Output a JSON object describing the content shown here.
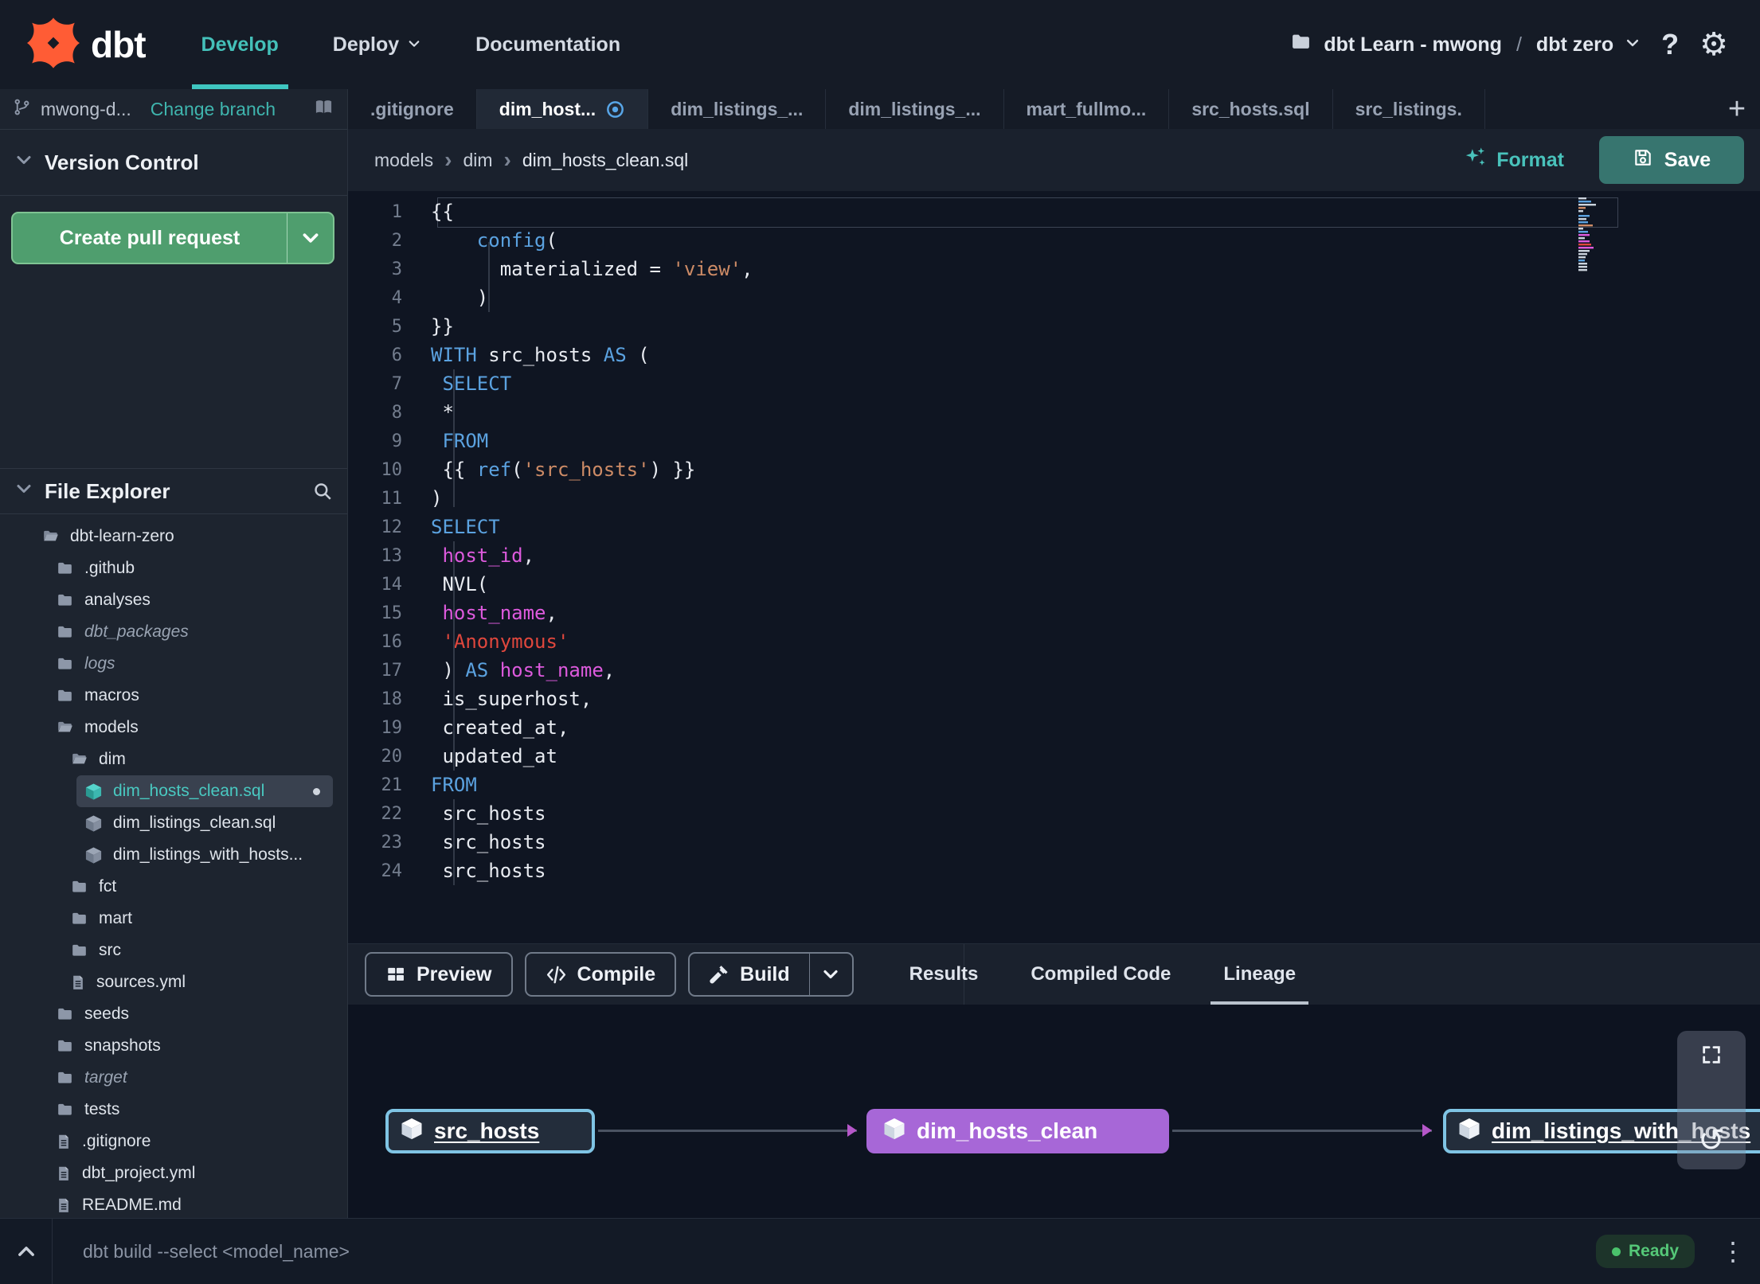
{
  "navbar": {
    "brand": "dbt",
    "items": [
      {
        "label": "Develop",
        "active": true,
        "chevron": false
      },
      {
        "label": "Deploy",
        "active": false,
        "chevron": true
      },
      {
        "label": "Documentation",
        "active": false,
        "chevron": false
      }
    ],
    "project": {
      "account": "dbt Learn - mwong",
      "separator": "/",
      "environment": "dbt zero"
    }
  },
  "icons": {
    "help": "?",
    "gear": "⚙",
    "undo": "↺",
    "kebab": "⋮",
    "plus": "+"
  },
  "colors": {
    "accent_teal": "#45c0ba",
    "brand_orange": "#ff5c35",
    "pr_green": "#4f9e6e",
    "node_purple": "#a767d7",
    "node_blue": "#7fc4e4",
    "ready_green": "#4ac26b",
    "modified_blue": "#58a6e8",
    "keyword_blue": "#5ba2e0",
    "ident_magenta": "#dd5add",
    "string_red": "#e0473d",
    "string_orange": "#cd8b66"
  },
  "sidebar": {
    "branch": {
      "name": "mwong-d...",
      "change_label": "Change branch"
    },
    "version_control": {
      "title": "Version Control",
      "create_pr_label": "Create pull request"
    },
    "file_explorer": {
      "title": "File Explorer",
      "tree": [
        {
          "name": "dbt-learn-zero",
          "type": "folder-open",
          "level": 0
        },
        {
          "name": ".github",
          "type": "folder",
          "level": 1
        },
        {
          "name": "analyses",
          "type": "folder",
          "level": 1
        },
        {
          "name": "dbt_packages",
          "type": "folder",
          "level": 1,
          "muted": true
        },
        {
          "name": "logs",
          "type": "folder",
          "level": 1,
          "muted": true
        },
        {
          "name": "macros",
          "type": "folder",
          "level": 1
        },
        {
          "name": "models",
          "type": "folder-open",
          "level": 1
        },
        {
          "name": "dim",
          "type": "folder-open",
          "level": 2
        },
        {
          "name": "dim_hosts_clean.sql",
          "type": "model",
          "level": 3,
          "selected": true,
          "modified": true
        },
        {
          "name": "dim_listings_clean.sql",
          "type": "model",
          "level": 3
        },
        {
          "name": "dim_listings_with_hosts...",
          "type": "model",
          "level": 3
        },
        {
          "name": "fct",
          "type": "folder",
          "level": 2
        },
        {
          "name": "mart",
          "type": "folder",
          "level": 2
        },
        {
          "name": "src",
          "type": "folder",
          "level": 2
        },
        {
          "name": "sources.yml",
          "type": "file",
          "level": 2
        },
        {
          "name": "seeds",
          "type": "folder",
          "level": 1
        },
        {
          "name": "snapshots",
          "type": "folder",
          "level": 1
        },
        {
          "name": "target",
          "type": "folder",
          "level": 1,
          "muted": true
        },
        {
          "name": "tests",
          "type": "folder",
          "level": 1
        },
        {
          "name": ".gitignore",
          "type": "file",
          "level": 1
        },
        {
          "name": "dbt_project.yml",
          "type": "file",
          "level": 1
        },
        {
          "name": "README.md",
          "type": "file",
          "level": 1
        }
      ]
    }
  },
  "tabs": [
    {
      "label": ".gitignore"
    },
    {
      "label": "dim_host...",
      "active": true,
      "modified": true
    },
    {
      "label": "dim_listings_..."
    },
    {
      "label": "dim_listings_..."
    },
    {
      "label": "mart_fullmo..."
    },
    {
      "label": "src_hosts.sql"
    },
    {
      "label": "src_listings."
    }
  ],
  "editor": {
    "breadcrumb": [
      "models",
      "dim",
      "dim_hosts_clean.sql"
    ],
    "format_label": "Format",
    "save_label": "Save",
    "lines": [
      {
        "n": 1,
        "segs": [
          [
            "{{",
            "w"
          ]
        ]
      },
      {
        "n": 2,
        "segs": [
          [
            "    ",
            "w"
          ],
          [
            "config",
            "k"
          ],
          [
            "(",
            "w"
          ]
        ]
      },
      {
        "n": 3,
        "segs": [
          [
            "      materialized = ",
            "w"
          ],
          [
            "'view'",
            "o"
          ],
          [
            ",",
            "w"
          ]
        ]
      },
      {
        "n": 4,
        "segs": [
          [
            "    )",
            "w"
          ]
        ]
      },
      {
        "n": 5,
        "segs": [
          [
            "}}",
            "w"
          ]
        ]
      },
      {
        "n": 6,
        "segs": [
          [
            "WITH",
            "k"
          ],
          [
            " src_hosts ",
            "w"
          ],
          [
            "AS",
            "k"
          ],
          [
            " (",
            "w"
          ]
        ]
      },
      {
        "n": 7,
        "segs": [
          [
            " ",
            "w"
          ],
          [
            "SELECT",
            "k"
          ]
        ]
      },
      {
        "n": 8,
        "segs": [
          [
            " *",
            "w"
          ]
        ]
      },
      {
        "n": 9,
        "segs": [
          [
            " ",
            "w"
          ],
          [
            "FROM",
            "k"
          ]
        ]
      },
      {
        "n": 10,
        "segs": [
          [
            " {{ ",
            "w"
          ],
          [
            "ref",
            "k"
          ],
          [
            "(",
            "w"
          ],
          [
            "'src_hosts'",
            "o"
          ],
          [
            ") }}",
            "w"
          ]
        ]
      },
      {
        "n": 11,
        "segs": [
          [
            ")",
            "w"
          ]
        ]
      },
      {
        "n": 12,
        "segs": [
          [
            "SELECT",
            "k"
          ]
        ]
      },
      {
        "n": 13,
        "segs": [
          [
            " ",
            "w"
          ],
          [
            "host_id",
            "m"
          ],
          [
            ",",
            "w"
          ]
        ]
      },
      {
        "n": 14,
        "segs": [
          [
            " NVL(",
            "w"
          ]
        ]
      },
      {
        "n": 15,
        "segs": [
          [
            " ",
            "w"
          ],
          [
            "host_name",
            "m"
          ],
          [
            ",",
            "w"
          ]
        ]
      },
      {
        "n": 16,
        "segs": [
          [
            " ",
            "w"
          ],
          [
            "'Anonymous'",
            "r"
          ]
        ]
      },
      {
        "n": 17,
        "segs": [
          [
            " ) ",
            "w"
          ],
          [
            "AS",
            "k"
          ],
          [
            " ",
            "w"
          ],
          [
            "host_name",
            "m"
          ],
          [
            ",",
            "w"
          ]
        ]
      },
      {
        "n": 18,
        "segs": [
          [
            " is_superhost,",
            "w"
          ]
        ]
      },
      {
        "n": 19,
        "segs": [
          [
            " created_at,",
            "w"
          ]
        ]
      },
      {
        "n": 20,
        "segs": [
          [
            " updated_at",
            "w"
          ]
        ]
      },
      {
        "n": 21,
        "segs": [
          [
            "FROM",
            "k"
          ]
        ]
      },
      {
        "n": 22,
        "segs": [
          [
            " src_hosts",
            "w"
          ]
        ]
      },
      {
        "n": 23,
        "segs": [
          [
            " src_hosts",
            "w"
          ]
        ]
      },
      {
        "n": 24,
        "segs": [
          [
            " src_hosts",
            "w"
          ]
        ]
      }
    ]
  },
  "panel": {
    "run_buttons": [
      {
        "label": "Preview",
        "icon": "preview-grid"
      },
      {
        "label": "Compile",
        "icon": "code-brackets"
      },
      {
        "label": "Build",
        "icon": "hammer",
        "split": true
      }
    ],
    "tabs": [
      {
        "label": "Results"
      },
      {
        "label": "Compiled Code"
      },
      {
        "label": "Lineage",
        "active": true
      }
    ]
  },
  "lineage": {
    "nodes": [
      {
        "label": "src_hosts",
        "style": "source"
      },
      {
        "label": "dim_hosts_clean",
        "style": "selected"
      },
      {
        "label": "dim_listings_with_hosts",
        "style": "source"
      }
    ]
  },
  "statusbar": {
    "command": "dbt build --select <model_name>",
    "status": "Ready"
  }
}
